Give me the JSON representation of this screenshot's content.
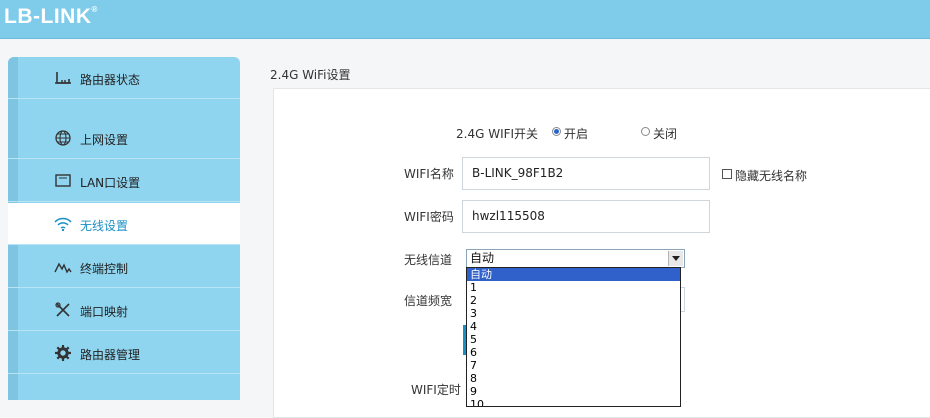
{
  "brand": {
    "logo_text": "LB-LINK",
    "registered": "®"
  },
  "sidebar": {
    "items": [
      {
        "label": "路由器状态",
        "icon": "router-icon"
      },
      {
        "label": "上网设置",
        "icon": "globe-icon"
      },
      {
        "label": "LAN口设置",
        "icon": "monitor-icon"
      },
      {
        "label": "无线设置",
        "icon": "wifi-icon",
        "active": true
      },
      {
        "label": "终端控制",
        "icon": "signal-icon"
      },
      {
        "label": "端口映射",
        "icon": "tools-icon"
      },
      {
        "label": "路由器管理",
        "icon": "gear-icon"
      }
    ]
  },
  "page": {
    "title": "2.4G WiFi设置"
  },
  "form": {
    "wifi_switch_label": "2.4G WIFI开关",
    "on_label": "开启",
    "off_label": "关闭",
    "wifi_switch_value": "开启",
    "ssid_label": "WIFI名称",
    "ssid_value": "B-LINK_98F1B2",
    "hide_ssid_label": "隐藏无线名称",
    "hide_ssid_checked": false,
    "password_label": "WIFI密码",
    "password_value": "hwzl115508",
    "channel_label": "无线信道",
    "channel_value": "自动",
    "bandwidth_label": "信道频宽",
    "timer_label": "WIFI定时"
  },
  "channel_options": [
    "自动",
    "1",
    "2",
    "3",
    "4",
    "5",
    "6",
    "7",
    "8",
    "9",
    "10"
  ],
  "colors": {
    "topbar": "#7fcbea",
    "sidebar": "#8fd5f0",
    "active_text": "#1a8fc6",
    "selected_option": "#3060c9"
  }
}
